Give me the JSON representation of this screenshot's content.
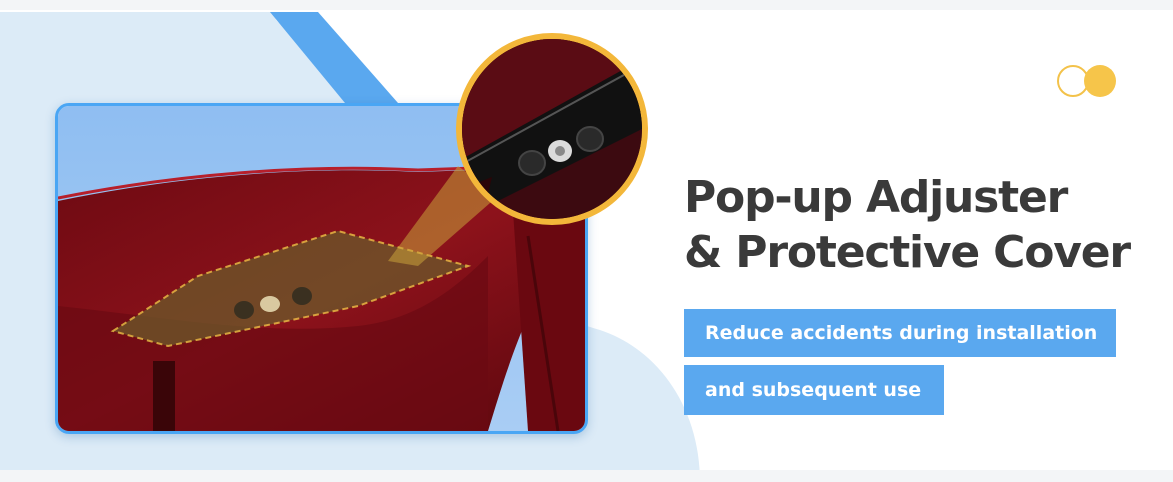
{
  "headline": {
    "line1": "Pop-up Adjuster",
    "line2": "& Protective Cover"
  },
  "tags": [
    "Reduce accidents during installation",
    "and subsequent use"
  ],
  "icons": {
    "toggle": "toggle-dots-icon"
  },
  "colors": {
    "headline": "#3a3a3a",
    "tag_background": "#5aa8ef",
    "tag_text": "#ffffff",
    "accent_blue": "#4aa6f4",
    "accent_gold": "#f3b73a",
    "fabric_red": "#8a0f18",
    "background_light_blue": "#dcebf7"
  }
}
